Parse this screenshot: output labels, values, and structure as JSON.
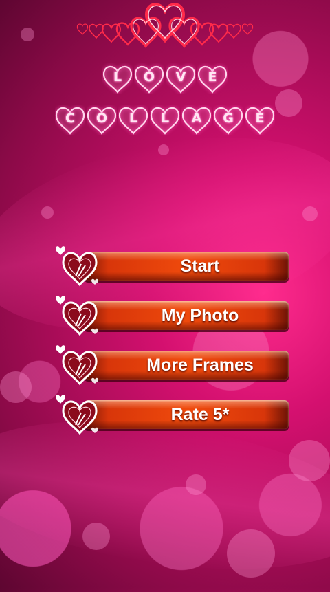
{
  "title": {
    "line1": [
      "L",
      "O",
      "V",
      "E"
    ],
    "line2": [
      "C",
      "O",
      "L",
      "L",
      "A",
      "G",
      "E"
    ]
  },
  "menu": {
    "items": [
      {
        "label": "Start",
        "name": "start-button"
      },
      {
        "label": "My Photo",
        "name": "my-photo-button"
      },
      {
        "label": "More Frames",
        "name": "more-frames-button"
      },
      {
        "label": "Rate 5*",
        "name": "rate-button"
      }
    ]
  },
  "colors": {
    "background": "#c0106a",
    "button": "#ef4a0c",
    "heart_outline": "#ff2a4a",
    "title_glow": "#ff4fb0"
  },
  "icons": {
    "garland": "hearts-garland-icon",
    "button_badge": "heart-doodle-icon"
  }
}
